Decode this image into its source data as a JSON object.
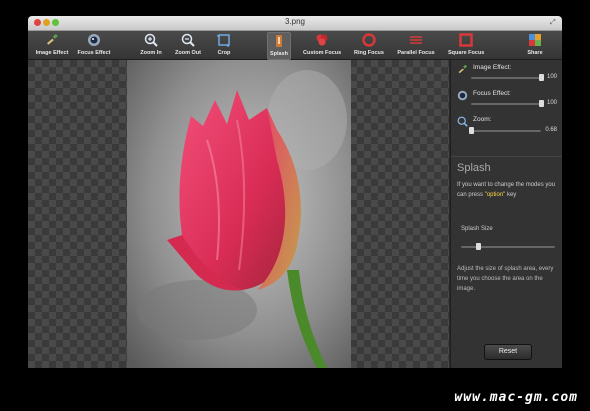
{
  "window": {
    "title": "3.png"
  },
  "toolbar": {
    "items": [
      {
        "label": "Image Effect",
        "icon": "image-effect-icon"
      },
      {
        "label": "Focus Effect",
        "icon": "focus-effect-icon"
      },
      {
        "label": "Zoom In",
        "icon": "zoom-in-icon"
      },
      {
        "label": "Zoom Out",
        "icon": "zoom-out-icon"
      },
      {
        "label": "Crop",
        "icon": "crop-icon"
      },
      {
        "label": "Splash",
        "icon": "splash-icon",
        "active": true
      },
      {
        "label": "Custom Focus",
        "icon": "custom-focus-icon"
      },
      {
        "label": "Ring Focus",
        "icon": "ring-focus-icon"
      },
      {
        "label": "Parallel Focus",
        "icon": "parallel-focus-icon"
      },
      {
        "label": "Square Focus",
        "icon": "square-focus-icon"
      },
      {
        "label": "Share",
        "icon": "share-icon"
      }
    ]
  },
  "panel": {
    "image_effect": {
      "label": "Image Effect:",
      "value": "100",
      "level": 1.0
    },
    "focus_effect": {
      "label": "Focus Effect:",
      "value": "100",
      "level": 1.0
    },
    "zoom": {
      "label": "Zoom:",
      "value": "0.68",
      "level": 0.0
    },
    "heading": "Splash",
    "help_pre": "If you want to change the modes you can press ",
    "help_key": "\"option\"",
    "help_post": " key",
    "splash_size_label": "Splash Size",
    "splash_size_level": 0.18,
    "adjust_text": "Adjust the size of splash area, every time you choose the area on the image.",
    "reset_label": "Reset"
  },
  "watermark": "www.mac-gm.com",
  "colors": {
    "accent_active": "#5e5e5e",
    "help_key": "#ffd84a",
    "tulip": "#e8335d"
  }
}
